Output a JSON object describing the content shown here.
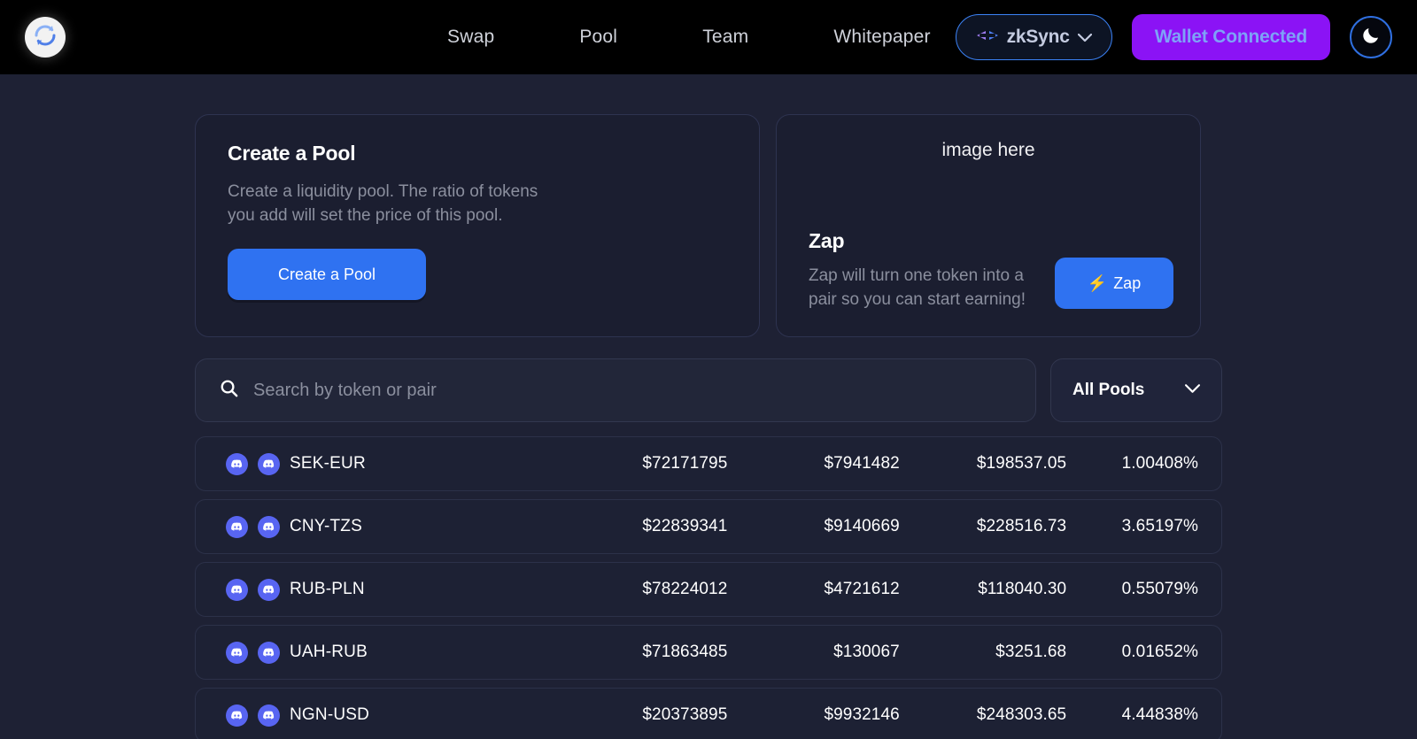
{
  "header": {
    "logo_icon": "refresh-circle-icon",
    "nav": [
      {
        "label": "Swap"
      },
      {
        "label": "Pool"
      },
      {
        "label": "Team"
      },
      {
        "label": "Whitepaper"
      }
    ],
    "chain_selector": {
      "icon": "bridge-arrows-icon",
      "label": "zkSync",
      "chevron": "⌄"
    },
    "wallet_button": {
      "label": "Wallet Connected"
    },
    "theme_toggle": {
      "icon": "moon-icon"
    }
  },
  "create_pool_card": {
    "title": "Create a Pool",
    "description": "Create a liquidity pool. The ratio of tokens you add will set the price of this pool.",
    "button_label": "Create a Pool"
  },
  "zap_card": {
    "image_placeholder": "image here",
    "title": "Zap",
    "description": "Zap will turn one token into a pair so you can start earning!",
    "button_label": "Zap",
    "button_icon": "⚡"
  },
  "search": {
    "icon": "search-icon",
    "placeholder": "Search by token or pair",
    "value": ""
  },
  "filter": {
    "selected": "All Pools",
    "chevron": "⌄"
  },
  "pools": [
    {
      "pair": "SEK-EUR",
      "icon_left": "discord-icon",
      "icon_right": "discord-icon",
      "col1": "$72171795",
      "col2": "$7941482",
      "col3": "$198537.05",
      "col4": "1.00408%"
    },
    {
      "pair": "CNY-TZS",
      "icon_left": "discord-icon",
      "icon_right": "discord-icon",
      "col1": "$22839341",
      "col2": "$9140669",
      "col3": "$228516.73",
      "col4": "3.65197%"
    },
    {
      "pair": "RUB-PLN",
      "icon_left": "discord-icon",
      "icon_right": "discord-icon",
      "col1": "$78224012",
      "col2": "$4721612",
      "col3": "$118040.30",
      "col4": "0.55079%"
    },
    {
      "pair": "UAH-RUB",
      "icon_left": "discord-icon",
      "icon_right": "discord-icon",
      "col1": "$71863485",
      "col2": "$130067",
      "col3": "$3251.68",
      "col4": "0.01652%"
    },
    {
      "pair": "NGN-USD",
      "icon_left": "discord-icon",
      "icon_right": "discord-icon",
      "col1": "$20373895",
      "col2": "$9932146",
      "col3": "$248303.65",
      "col4": "4.44838%"
    }
  ],
  "colors": {
    "page_background": "#1e2134",
    "header_background": "#000000",
    "accent_blue": "#2f72f1",
    "wallet_purple": "#8b13f5",
    "wallet_text": "#7ea2f7",
    "token_blue": "#5865f2",
    "muted_text": "#8b8f9e"
  }
}
